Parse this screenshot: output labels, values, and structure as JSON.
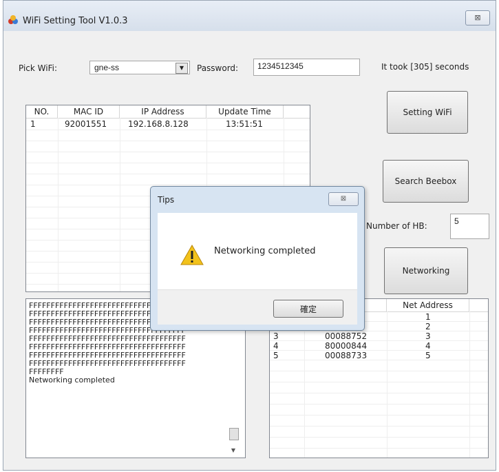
{
  "window": {
    "title": "WiFi Setting Tool V1.0.3",
    "close_label": "⊠"
  },
  "form": {
    "pick_wifi_label": "Pick WiFi:",
    "wifi_value": "gne-ss",
    "password_label": "Password:",
    "password_value": "1234512345",
    "elapsed_text": "It took [305] seconds",
    "hb_label": "Number of HB:",
    "hb_value": "5"
  },
  "buttons": {
    "setting_wifi": "Setting WiFi",
    "search_beebox": "Search Beebox",
    "networking": "Networking"
  },
  "device_table": {
    "columns": [
      "NO.",
      "MAC ID",
      "IP Address",
      "Update Time"
    ],
    "rows": [
      {
        "no": "1",
        "mac": "92001551",
        "ip": "192.168.8.128",
        "time": "13:51:51"
      }
    ]
  },
  "log": {
    "lines": [
      "FFFFFFFFFFFFFFFFFFFFFFFFFFFFFFFFFFFF",
      "FFFFFFFFFFFFFFFFFFFFFFFFFFFFFFFFFFFF",
      "FFFFFFFFFFFFFFFFFFFFFFFFFFFFFFFFFFFF",
      "FFFFFFFFFFFFFFFFFFFFFFFFFFFFFFFFFFFF",
      "FFFFFFFFFFFFFFFFFFFFFFFFFFFFFFFFFFFF",
      "FFFFFFFFFFFFFFFFFFFFFFFFFFFFFFFFFFFF",
      "FFFFFFFFFFFFFFFFFFFFFFFFFFFFFFFFFFFF",
      "FFFFFFFFFFFFFFFFFFFFFFFFFFFFFFFFFFFF",
      "FFFFFFFF",
      "Networking completed"
    ]
  },
  "hb_table": {
    "net_address_header": "Net Address",
    "rows": [
      {
        "no": "",
        "mac": "",
        "net": "1"
      },
      {
        "no": "",
        "mac": "",
        "net": "2"
      },
      {
        "no": "3",
        "mac": "00088752",
        "net": "3"
      },
      {
        "no": "4",
        "mac": "80000844",
        "net": "4"
      },
      {
        "no": "5",
        "mac": "00088733",
        "net": "5"
      }
    ]
  },
  "dialog": {
    "title": "Tips",
    "close_label": "⊠",
    "message": "Networking completed",
    "ok_label": "確定"
  },
  "colors": {
    "warning_fill": "#f2c21b",
    "dialog_frame": "#d7e4f2"
  }
}
